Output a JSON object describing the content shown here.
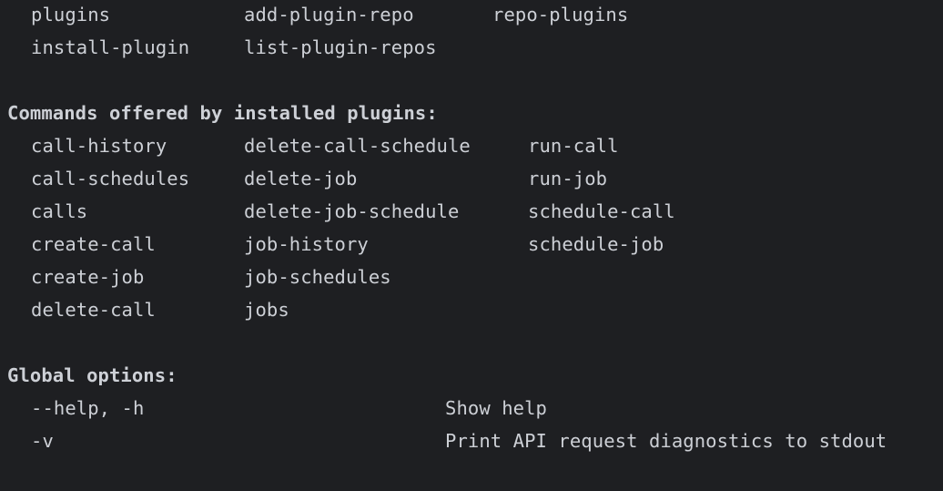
{
  "intro_commands": {
    "rows": [
      [
        "plugins",
        "add-plugin-repo",
        "repo-plugins"
      ],
      [
        "install-plugin",
        "list-plugin-repos",
        ""
      ]
    ]
  },
  "plugin_commands": {
    "heading": "Commands offered by installed plugins:",
    "rows": [
      [
        "call-history",
        "delete-call-schedule",
        "run-call"
      ],
      [
        "call-schedules",
        "delete-job",
        "run-job"
      ],
      [
        "calls",
        "delete-job-schedule",
        "schedule-call"
      ],
      [
        "create-call",
        "job-history",
        "schedule-job"
      ],
      [
        "create-job",
        "job-schedules",
        ""
      ],
      [
        "delete-call",
        "jobs",
        ""
      ]
    ]
  },
  "global_options": {
    "heading": "Global options:",
    "rows": [
      {
        "flag": "--help, -h",
        "description": "Show help"
      },
      {
        "flag": "-v",
        "description": "Print API request diagnostics to stdout"
      }
    ]
  },
  "colors": {
    "background": "#1e1f22",
    "text": "#cdd0d6"
  }
}
